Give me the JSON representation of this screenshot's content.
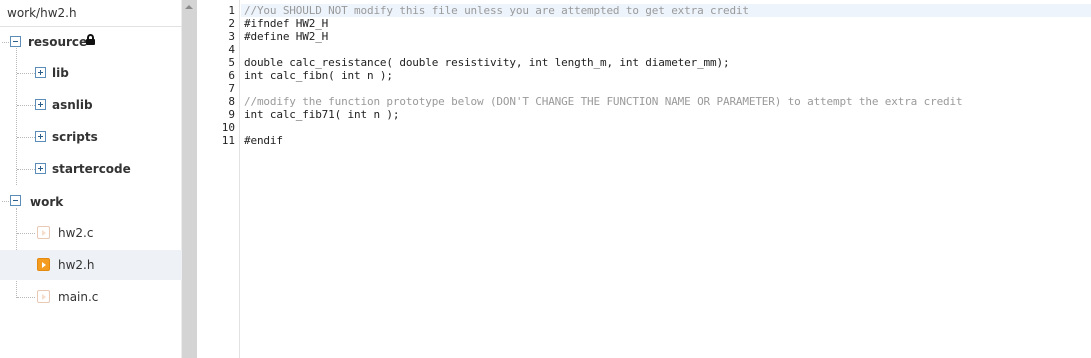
{
  "sidebar": {
    "path": "work/hw2.h",
    "tree": {
      "resource": {
        "label": "resource",
        "children": [
          "lib",
          "asnlib",
          "scripts",
          "startercode"
        ]
      },
      "work": {
        "label": "work",
        "files": [
          "hw2.c",
          "hw2.h",
          "main.c"
        ],
        "active_file": "hw2.h"
      }
    }
  },
  "editor": {
    "lines": [
      {
        "no": "1",
        "text": "//You SHOULD NOT modify this file unless you are attempted to get extra credit",
        "kind": "comment"
      },
      {
        "no": "2",
        "text": "#ifndef HW2_H",
        "kind": "code"
      },
      {
        "no": "3",
        "text": "#define HW2_H",
        "kind": "code"
      },
      {
        "no": "4",
        "text": "",
        "kind": "code"
      },
      {
        "no": "5",
        "text": "double calc_resistance( double resistivity, int length_m, int diameter_mm);",
        "kind": "code"
      },
      {
        "no": "6",
        "text": "int calc_fibn( int n );",
        "kind": "code"
      },
      {
        "no": "7",
        "text": "",
        "kind": "code"
      },
      {
        "no": "8",
        "text": "//modify the function prototype below (DON'T CHANGE THE FUNCTION NAME OR PARAMETER) to attempt the extra credit",
        "kind": "comment"
      },
      {
        "no": "9",
        "text": "int calc_fib71( int n );",
        "kind": "code"
      },
      {
        "no": "10",
        "text": "",
        "kind": "code"
      },
      {
        "no": "11",
        "text": "#endif",
        "kind": "code"
      }
    ]
  },
  "colors": {
    "accent_file": "#f39c1f",
    "comment": "#9a9a9a",
    "selection_row": "#eef2f6",
    "current_line": "#edf4fc"
  },
  "icons": {
    "folder_expanded": "minus-box-icon",
    "folder_collapsed": "plus-box-icon",
    "locked": "lock-icon",
    "file": "file-icon"
  }
}
